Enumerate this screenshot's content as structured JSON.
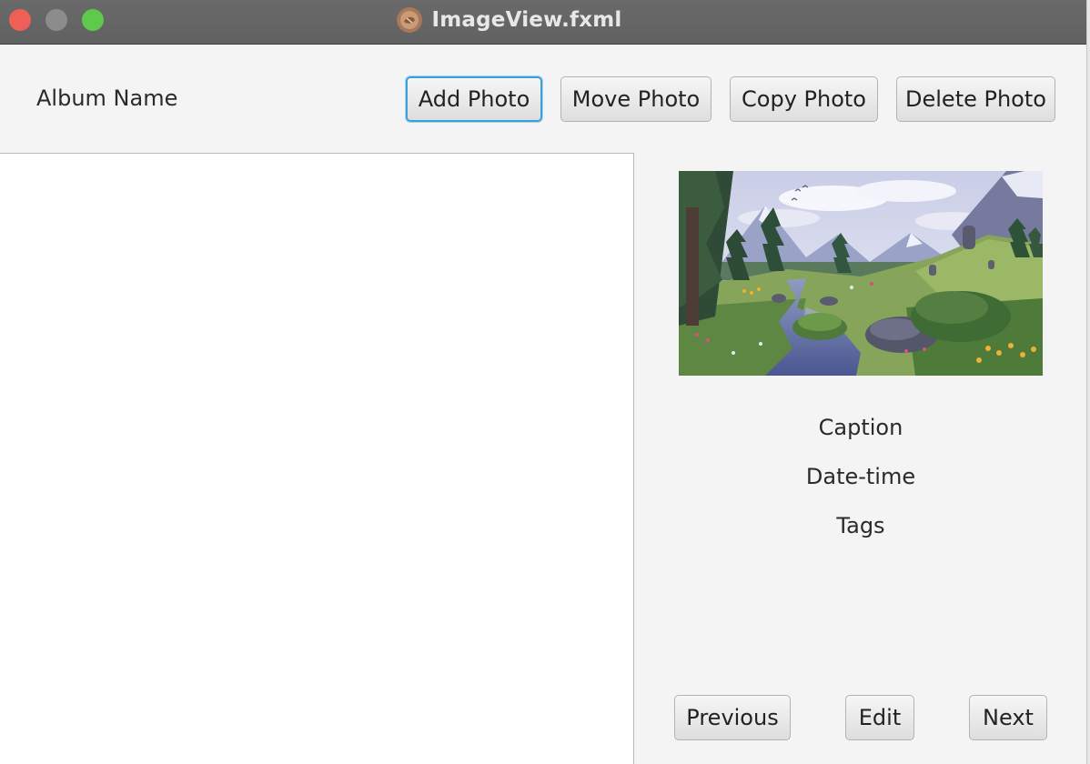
{
  "window": {
    "title": "ImageView.fxml"
  },
  "toolbar": {
    "album_name": "Album Name",
    "add_photo": "Add Photo",
    "move_photo": "Move Photo",
    "copy_photo": "Copy Photo",
    "delete_photo": "Delete Photo"
  },
  "details": {
    "caption": "Caption",
    "datetime": "Date-time",
    "tags": "Tags"
  },
  "navigation": {
    "previous": "Previous",
    "edit": "Edit",
    "next": "Next"
  },
  "icons": {
    "app_icon": "java-app-icon",
    "photo": "pixel-art-landscape-image"
  },
  "colors": {
    "titlebar": "#656565",
    "close": "#ee5f57",
    "minimize": "#8c8c8c",
    "maximize": "#5fc94c",
    "focus_ring": "#3c9fd9"
  }
}
